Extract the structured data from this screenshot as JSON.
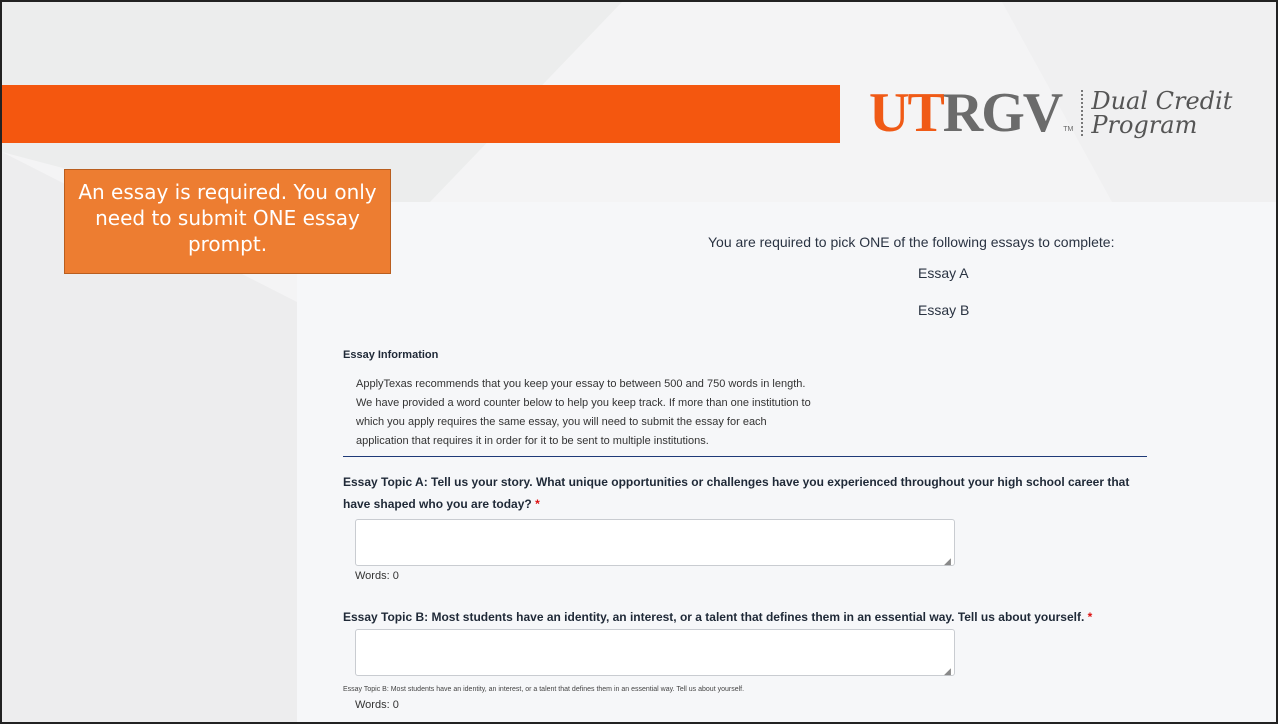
{
  "logo": {
    "ut": "UT",
    "rgv": "RGV",
    "tm": "TM",
    "line1": "Dual Credit",
    "line2": "Program"
  },
  "callout": {
    "text": "An essay is required. You only need to submit ONE essay prompt."
  },
  "page": {
    "pick_text": "You are required to pick ONE of the following essays to complete:",
    "essay_a": "Essay A",
    "essay_b": "Essay B"
  },
  "info": {
    "title": "Essay Information",
    "line1": "ApplyTexas recommends that you keep your essay to between 500 and 750 words in length.",
    "line2": "We have provided a word counter below to help you keep track. If more than one institution to",
    "line3": "which you apply requires the same essay, you will need to submit the essay for each",
    "line4": "application that requires it in order for it to be sent to multiple institutions."
  },
  "topic_a": {
    "line1": "Essay Topic A: Tell us your story. What unique opportunities or challenges have you experienced throughout your high school career that",
    "line2": "have shaped who you are today?",
    "required": "*",
    "value": "",
    "words": "Words: 0"
  },
  "topic_b": {
    "label": "Essay Topic B: Most students have an identity, an interest, or a talent that defines them in an essential way. Tell us about yourself.",
    "required": "*",
    "value": "",
    "helper": "Essay Topic B: Most students have an identity, an interest, or a talent that defines them in an essential way. Tell us about yourself.",
    "words": "Words: 0"
  },
  "colors": {
    "banner": "#f4570f",
    "callout": "#ed7d31",
    "rule": "#1e3a78"
  }
}
